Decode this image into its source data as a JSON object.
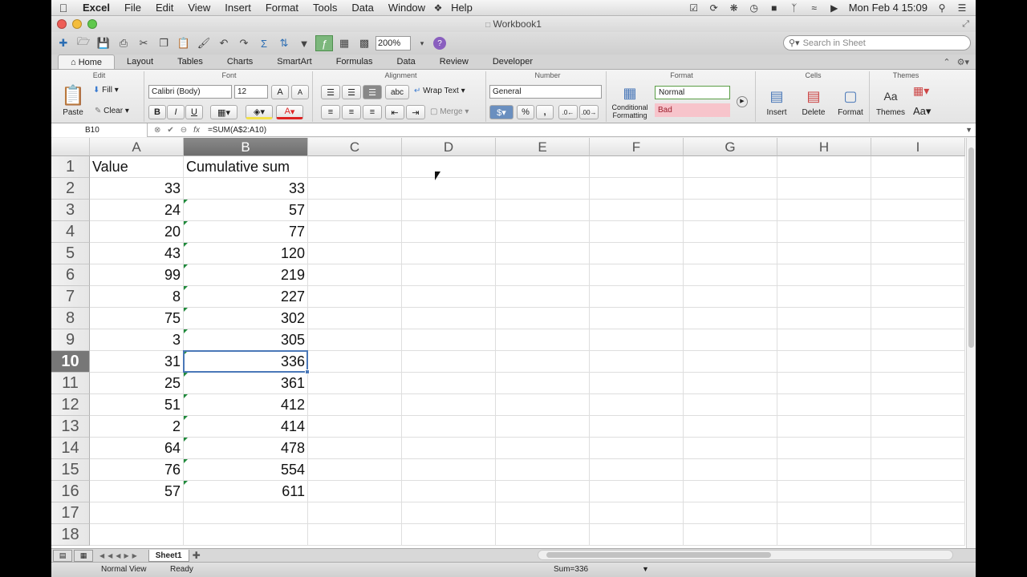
{
  "menu": {
    "app": "Excel",
    "items": [
      "File",
      "Edit",
      "View",
      "Insert",
      "Format",
      "Tools",
      "Data",
      "Window",
      "Help"
    ]
  },
  "clock": "Mon Feb 4  15:09",
  "window_title": "Workbook1",
  "toolbar": {
    "zoom": "200%",
    "search_placeholder": "Search in Sheet"
  },
  "ribbon_tabs": [
    "Home",
    "Layout",
    "Tables",
    "Charts",
    "SmartArt",
    "Formulas",
    "Data",
    "Review",
    "Developer"
  ],
  "ribbon": {
    "groups": {
      "edit": "Edit",
      "font": "Font",
      "alignment": "Alignment",
      "number": "Number",
      "format": "Format",
      "cells": "Cells",
      "themes": "Themes"
    },
    "paste": "Paste",
    "fill": "Fill",
    "clear": "Clear",
    "font_name": "Calibri (Body)",
    "font_size": "12",
    "bold": "B",
    "italic": "I",
    "underline": "U",
    "grow_font": "A",
    "shrink_font": "A",
    "wrap_text": "Wrap Text",
    "merge": "Merge",
    "abc": "abc",
    "number_format": "General",
    "percent": "%",
    "comma": ",",
    "conditional": "Conditional",
    "formatting": "Formatting",
    "style_normal": "Normal",
    "style_bad": "Bad",
    "insert": "Insert",
    "delete": "Delete",
    "format": "Format",
    "themes": "Themes",
    "theme_aa": "Aa"
  },
  "formula_bar": {
    "name_box": "B10",
    "fx": "fx",
    "formula": "=SUM(A$2:A10)"
  },
  "columns": [
    "A",
    "B",
    "C",
    "D",
    "E",
    "F",
    "G",
    "H",
    "I"
  ],
  "rows": [
    "1",
    "2",
    "3",
    "4",
    "5",
    "6",
    "7",
    "8",
    "9",
    "10",
    "11",
    "12",
    "13",
    "14",
    "15",
    "16",
    "17",
    "18"
  ],
  "cells": {
    "header": [
      "Value",
      "Cumulative sum"
    ],
    "values": [
      "33",
      "24",
      "20",
      "43",
      "99",
      "8",
      "75",
      "3",
      "31",
      "25",
      "51",
      "2",
      "64",
      "76",
      "57"
    ],
    "cumulative": [
      "33",
      "57",
      "77",
      "120",
      "219",
      "227",
      "302",
      "305",
      "336",
      "361",
      "412",
      "414",
      "478",
      "554",
      "611"
    ]
  },
  "selection": {
    "cell": "B10",
    "column": "B",
    "row": "10"
  },
  "sheet_tabs": [
    "Sheet1"
  ],
  "status": {
    "view": "Normal View",
    "mode": "Ready",
    "sum": "Sum=336"
  },
  "colors": {
    "selection": "#4a78b8",
    "error_indicator": "#1f8a3b",
    "bad_style": "#f7c4cb"
  }
}
